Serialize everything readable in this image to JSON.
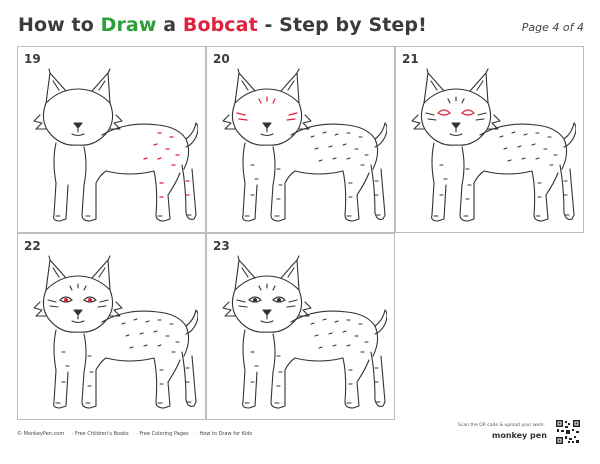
{
  "header": {
    "part1": "How to ",
    "part2": "Draw",
    "part3": " a ",
    "part4": "Bobcat",
    "part5": " - Step by Step!"
  },
  "page_indicator": "Page 4 of 4",
  "steps": [
    {
      "number": "19",
      "highlight": "body spots"
    },
    {
      "number": "20",
      "highlight": "face markings"
    },
    {
      "number": "21",
      "highlight": "eye markings"
    },
    {
      "number": "22",
      "highlight": "eyes"
    },
    {
      "number": "23",
      "highlight": "none"
    }
  ],
  "colors": {
    "green": "#2e9e3a",
    "red": "#e0203c",
    "line": "#333333",
    "highlight": "#e0203c"
  },
  "footer": {
    "links": [
      "© MonkeyPen.com",
      "· Free Children's Books",
      "· Free Coloring Pages",
      "· How to Draw for Kids"
    ],
    "scan_text": "Scan the QR code & upload your work.",
    "brand": "monkey pen"
  }
}
